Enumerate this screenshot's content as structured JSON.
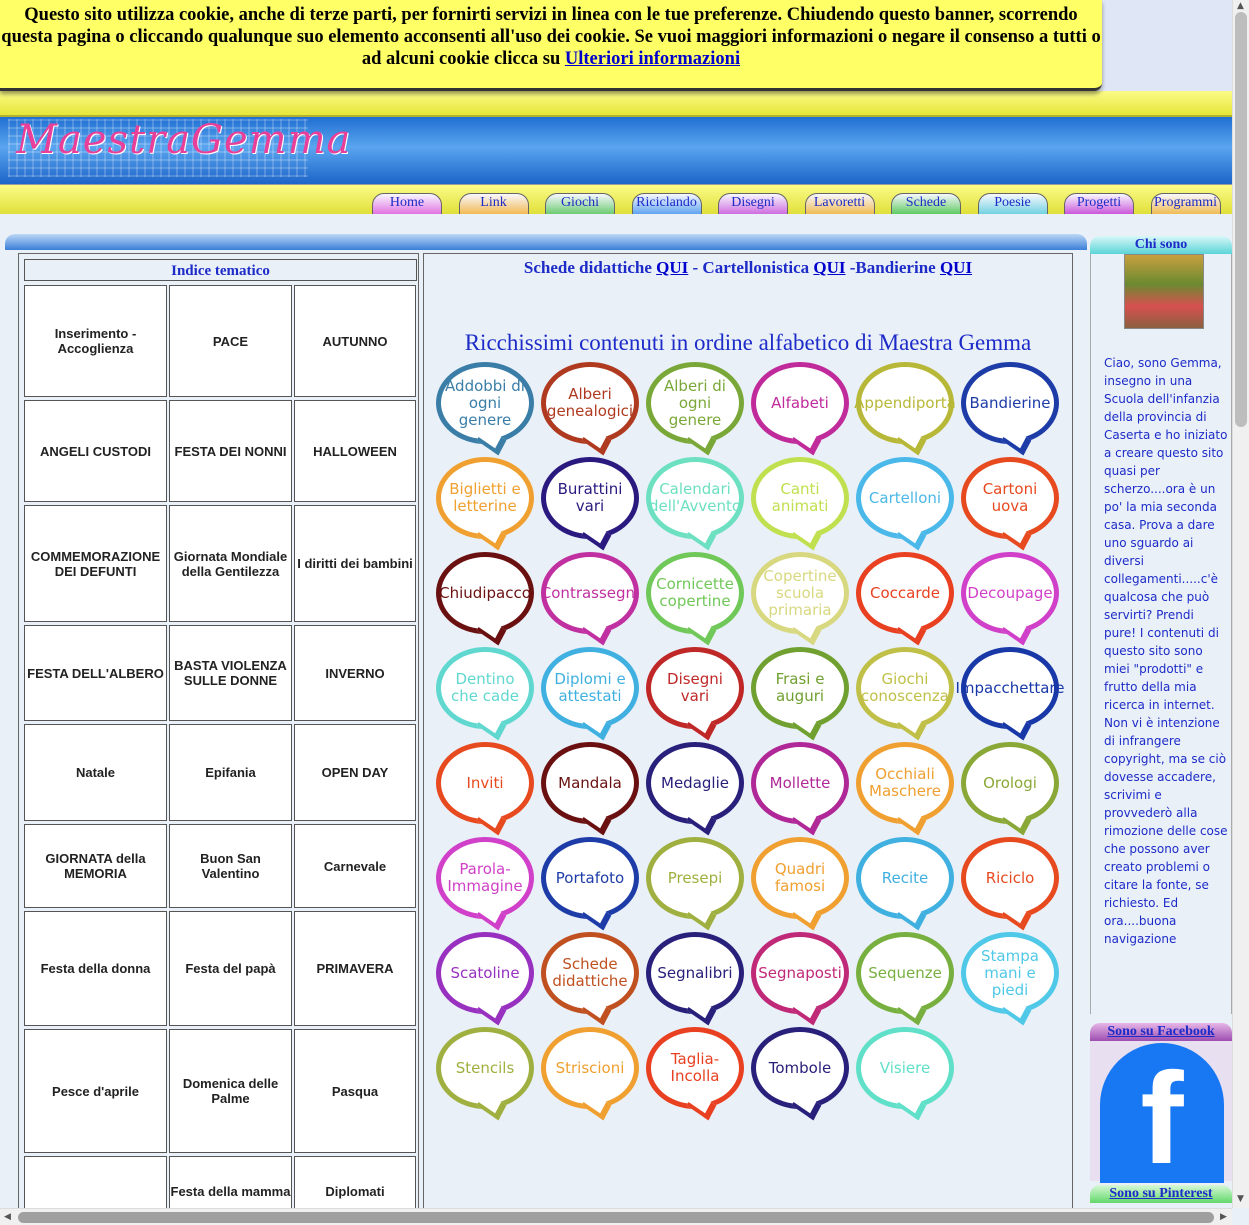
{
  "cookie": {
    "text": "Questo sito utilizza cookie, anche di terze parti, per fornirti servizi in linea con le tue preferenze. Chiudendo questo banner, scorrendo questa pagina o cliccando qualunque suo elemento acconsenti all'uso dei cookie. Se vuoi maggiori informazioni o negare il consenso a tutti o ad alcuni cookie clicca su",
    "link": "Ulteriori informazioni"
  },
  "header": {
    "logo": "MaestraGemma"
  },
  "nav": [
    {
      "label": "Home",
      "color": "#e06ce0"
    },
    {
      "label": "Link",
      "color": "#f2b64a"
    },
    {
      "label": "Giochi",
      "color": "#66c86a"
    },
    {
      "label": "Riciclando",
      "color": "#5aa0f0"
    },
    {
      "label": "Disegni",
      "color": "#cc66dd"
    },
    {
      "label": "Lavoretti",
      "color": "#f0b84a"
    },
    {
      "label": "Schede",
      "color": "#58c85a"
    },
    {
      "label": "Poesie",
      "color": "#6cd0e0"
    },
    {
      "label": "Progetti",
      "color": "#c850d8"
    },
    {
      "label": "Programmi",
      "color": "#f0b84a"
    }
  ],
  "index": {
    "title": "Indice tematico",
    "cells": [
      "Inserimento - Accoglienza",
      "PACE",
      "AUTUNNO",
      "ANGELI CUSTODI",
      "FESTA DEI NONNI",
      "HALLOWEEN",
      "COMMEMORAZIONE DEI DEFUNTI",
      "Giornata Mondiale della Gentilezza",
      "I diritti dei bambini",
      "FESTA DELL'ALBERO",
      "BASTA VIOLENZA SULLE DONNE",
      "INVERNO",
      "Natale",
      "Epifania",
      "OPEN DAY",
      "GIORNATA della MEMORIA",
      "Buon San Valentino",
      "Carnevale",
      "Festa della donna",
      "Festa del papà",
      "PRIMAVERA",
      "Pesce d'aprile",
      "Domenica delle Palme",
      "Pasqua",
      "",
      "Festa della mamma",
      "Diplomati"
    ]
  },
  "center": {
    "top_prefix1": "Schede didattiche ",
    "qui1": "QUI",
    "top_mid": " - Cartellonistica ",
    "qui2": "QUI",
    "top_mid2": " -Bandierine ",
    "qui3": "QUI",
    "title": "Ricchissimi contenuti in ordine alfabetico di Maestra Gemma",
    "bubbles": [
      {
        "label": "Addobbi di ogni genere",
        "color": "#3a7ea8"
      },
      {
        "label": "Alberi genealogici",
        "color": "#b03a20"
      },
      {
        "label": "Alberi di ogni genere",
        "color": "#7aa838"
      },
      {
        "label": "Alfabeti",
        "color": "#c02a9a"
      },
      {
        "label": "Appendiporta",
        "color": "#b8b838"
      },
      {
        "label": "Bandierine",
        "color": "#1d3ca8"
      },
      {
        "label": "Biglietti e letterine",
        "color": "#f0a030"
      },
      {
        "label": "Burattini vari",
        "color": "#2a1a80"
      },
      {
        "label": "Calendari dell'Avvento",
        "color": "#6ce0c0"
      },
      {
        "label": "Canti animati",
        "color": "#c0e050"
      },
      {
        "label": "Cartelloni",
        "color": "#4ab8e8"
      },
      {
        "label": "Cartoni uova",
        "color": "#e84a20"
      },
      {
        "label": "Chiudipacco",
        "color": "#6a1010"
      },
      {
        "label": "Contrassegni",
        "color": "#c030a0"
      },
      {
        "label": "Cornicette copertine",
        "color": "#70c858"
      },
      {
        "label": "Copertine scuola primaria",
        "color": "#d8d880"
      },
      {
        "label": "Coccarde",
        "color": "#e84020"
      },
      {
        "label": "Decoupage",
        "color": "#d040c8"
      },
      {
        "label": "Dentino che cade",
        "color": "#60d8d0"
      },
      {
        "label": "Diplomi e attestati",
        "color": "#40b0e0"
      },
      {
        "label": "Disegni vari",
        "color": "#c02828"
      },
      {
        "label": "Frasi e auguri",
        "color": "#70a030"
      },
      {
        "label": "Giochi conoscenza",
        "color": "#c0c048"
      },
      {
        "label": "Impacchettare",
        "color": "#1838a8"
      },
      {
        "label": "Inviti",
        "color": "#e84a20"
      },
      {
        "label": "Mandala",
        "color": "#6a1010"
      },
      {
        "label": "Medaglie",
        "color": "#28207a"
      },
      {
        "label": "Mollette",
        "color": "#b02898"
      },
      {
        "label": "Occhiali Maschere",
        "color": "#f0a030"
      },
      {
        "label": "Orologi",
        "color": "#8aa838"
      },
      {
        "label": "Parola-Immagine",
        "color": "#d040c8"
      },
      {
        "label": "Portafoto",
        "color": "#1d3ca8"
      },
      {
        "label": "Presepi",
        "color": "#a0b040"
      },
      {
        "label": "Quadri famosi",
        "color": "#f0a030"
      },
      {
        "label": "Recite",
        "color": "#40b0e0"
      },
      {
        "label": "Riciclo",
        "color": "#e84a20"
      },
      {
        "label": "Scatoline",
        "color": "#9830c0"
      },
      {
        "label": "Schede didattiche",
        "color": "#c05020"
      },
      {
        "label": "Segnalibri",
        "color": "#28207a"
      },
      {
        "label": "Segnaposti",
        "color": "#c02878"
      },
      {
        "label": "Sequenze",
        "color": "#78b040"
      },
      {
        "label": "Stampa mani e piedi",
        "color": "#50c8e8"
      },
      {
        "label": "Stencils",
        "color": "#a0b040"
      },
      {
        "label": "Striscioni",
        "color": "#f0a030"
      },
      {
        "label": "Taglia-Incolla",
        "color": "#e84020"
      },
      {
        "label": "Tombole",
        "color": "#28207a"
      },
      {
        "label": "Visiere",
        "color": "#60e0c8"
      }
    ]
  },
  "right": {
    "chi_title": "Chi sono",
    "chi_text": "Ciao, sono Gemma, insegno in una Scuola dell'infanzia della provincia di Caserta e ho iniziato a creare questo sito quasi per scherzo....ora è un po'  la mia seconda casa. Prova a dare uno sguardo ai diversi collegamenti.....c'è qualcosa che può servirti? Prendi pure! I contenuti di questo sito sono miei \"prodotti\" e frutto della mia ricerca in internet.  Non vi è intenzione di infrangere copyright,  ma  se ciò dovesse accadere, scrivimi e provvederò alla rimozione delle cose che possono aver  creato problemi o citare la fonte, se richiesto. Ed ora....buona navigazione",
    "fb_title": "Sono su Facebook",
    "pin_title": "Sono su Pinterest"
  }
}
